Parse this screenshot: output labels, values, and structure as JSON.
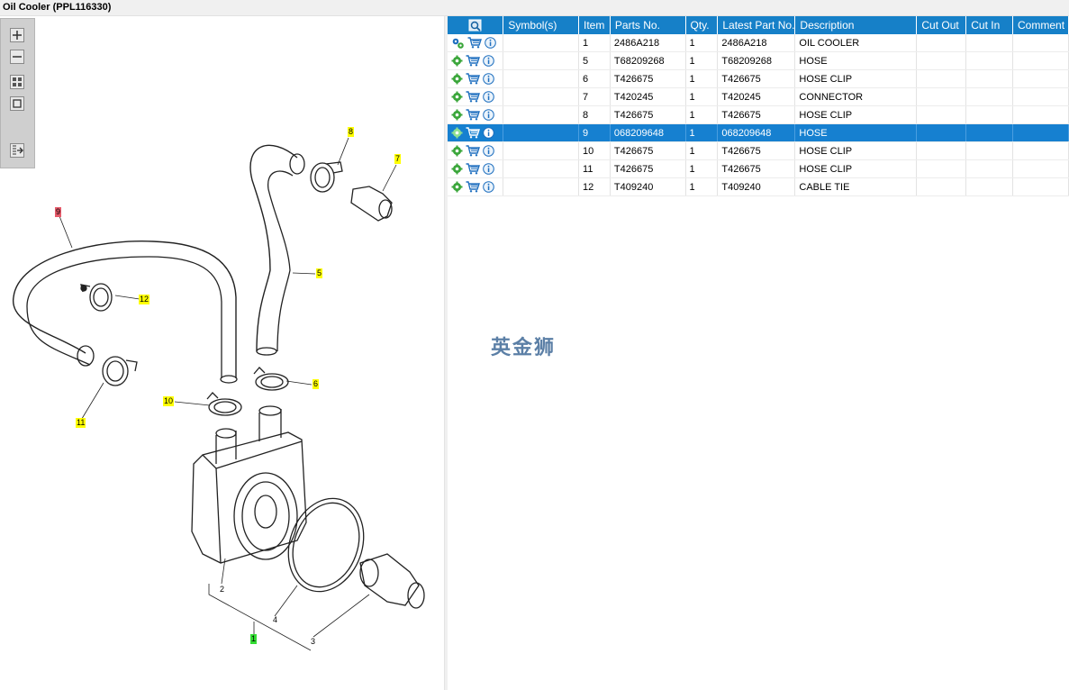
{
  "window": {
    "title": "Oil Cooler (PPL116330)"
  },
  "table": {
    "headers": [
      "",
      "Symbol(s)",
      "Item",
      "Parts No.",
      "Qty.",
      "Latest Part No.",
      "Description",
      "Cut Out",
      "Cut In",
      "Comment"
    ],
    "rows": [
      {
        "item": "1",
        "part_no": "2486A218",
        "qty": "1",
        "latest": "2486A218",
        "description": "OIL COOLER",
        "selected": false,
        "gear": "gears"
      },
      {
        "item": "5",
        "part_no": "T68209268",
        "qty": "1",
        "latest": "T68209268",
        "description": "HOSE",
        "selected": false,
        "gear": "gear"
      },
      {
        "item": "6",
        "part_no": "T426675",
        "qty": "1",
        "latest": "T426675",
        "description": "HOSE CLIP",
        "selected": false,
        "gear": "gear"
      },
      {
        "item": "7",
        "part_no": "T420245",
        "qty": "1",
        "latest": "T420245",
        "description": "CONNECTOR",
        "selected": false,
        "gear": "gear"
      },
      {
        "item": "8",
        "part_no": "T426675",
        "qty": "1",
        "latest": "T426675",
        "description": "HOSE CLIP",
        "selected": false,
        "gear": "gear"
      },
      {
        "item": "9",
        "part_no": "068209648",
        "qty": "1",
        "latest": "068209648",
        "description": "HOSE",
        "selected": true,
        "gear": "gear"
      },
      {
        "item": "10",
        "part_no": "T426675",
        "qty": "1",
        "latest": "T426675",
        "description": "HOSE CLIP",
        "selected": false,
        "gear": "gear"
      },
      {
        "item": "11",
        "part_no": "T426675",
        "qty": "1",
        "latest": "T426675",
        "description": "HOSE CLIP",
        "selected": false,
        "gear": "gear"
      },
      {
        "item": "12",
        "part_no": "T409240",
        "qty": "1",
        "latest": "T409240",
        "description": "CABLE TIE",
        "selected": false,
        "gear": "gear"
      }
    ]
  },
  "diagram": {
    "callouts": [
      "8",
      "7",
      "9",
      "5",
      "12",
      "6",
      "10",
      "11",
      "2",
      "4",
      "3",
      "1"
    ]
  },
  "toolbar": {
    "icons": [
      "zoom-in-icon",
      "zoom-out-icon",
      "fit-all-icon",
      "actual-size-icon",
      "export-icon"
    ]
  },
  "watermark": "英金狮",
  "colors": {
    "header": "#1680c8",
    "selected_row": "#1680d0",
    "callout_highlight": "#ffff00",
    "callout_selected": "#e65a6a",
    "callout_main": "#33dd33"
  }
}
